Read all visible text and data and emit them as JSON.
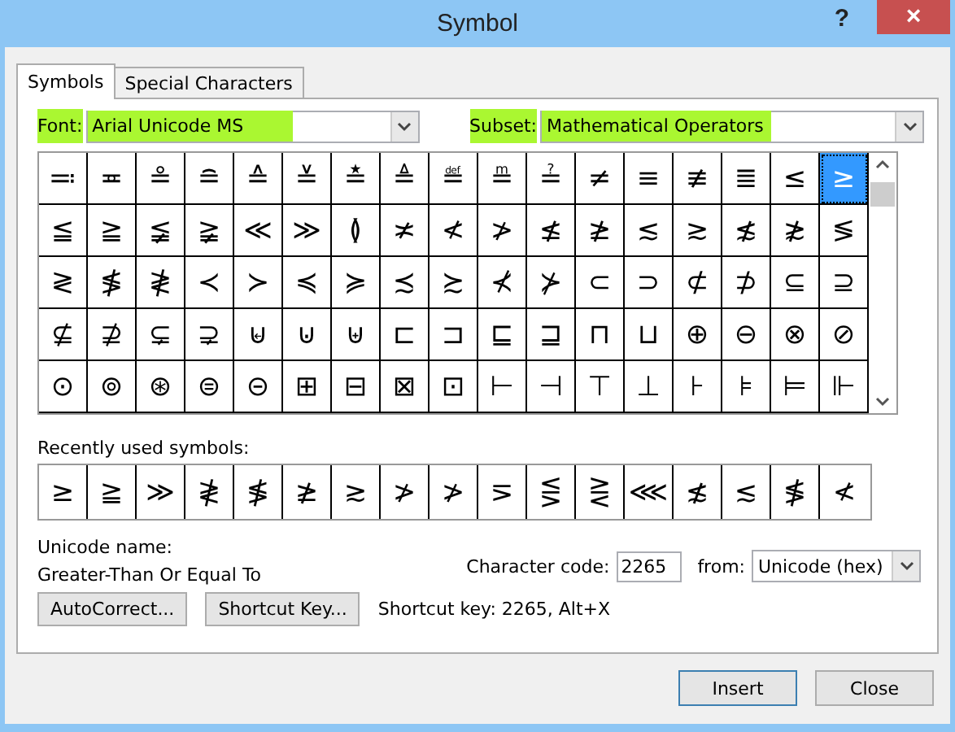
{
  "window": {
    "title": "Symbol",
    "help": "?",
    "close": "×"
  },
  "tabs": [
    {
      "label": "Symbols",
      "selected": true
    },
    {
      "label": "Special Characters",
      "selected": false
    }
  ],
  "font": {
    "label": "Font:",
    "value": "Arial Unicode MS",
    "highlighted": true
  },
  "subset": {
    "label": "Subset:",
    "value": "Mathematical Operators",
    "highlighted": true
  },
  "symbols": [
    {
      "char": "≕",
      "selected": false
    },
    {
      "char": "≖",
      "selected": false
    },
    {
      "char": "≗",
      "selected": false
    },
    {
      "char": "≘",
      "selected": false
    },
    {
      "char": "≙",
      "selected": false
    },
    {
      "char": "≚",
      "selected": false
    },
    {
      "char": "≛",
      "selected": false
    },
    {
      "char": "≜",
      "selected": false
    },
    {
      "char": "≝",
      "selected": false
    },
    {
      "char": "≞",
      "selected": false
    },
    {
      "char": "≟",
      "selected": false
    },
    {
      "char": "≠",
      "selected": false
    },
    {
      "char": "≡",
      "selected": false
    },
    {
      "char": "≢",
      "selected": false
    },
    {
      "char": "≣",
      "selected": false
    },
    {
      "char": "≤",
      "selected": false
    },
    {
      "char": "≥",
      "selected": true
    },
    {
      "char": "≦",
      "selected": false
    },
    {
      "char": "≧",
      "selected": false
    },
    {
      "char": "≨",
      "selected": false
    },
    {
      "char": "≩",
      "selected": false
    },
    {
      "char": "≪",
      "selected": false
    },
    {
      "char": "≫",
      "selected": false
    },
    {
      "char": "≬",
      "selected": false
    },
    {
      "char": "≭",
      "selected": false
    },
    {
      "char": "≮",
      "selected": false
    },
    {
      "char": "≯",
      "selected": false
    },
    {
      "char": "≰",
      "selected": false
    },
    {
      "char": "≱",
      "selected": false
    },
    {
      "char": "≲",
      "selected": false
    },
    {
      "char": "≳",
      "selected": false
    },
    {
      "char": "≴",
      "selected": false
    },
    {
      "char": "≵",
      "selected": false
    },
    {
      "char": "≶",
      "selected": false
    },
    {
      "char": "≷",
      "selected": false
    },
    {
      "char": "≸",
      "selected": false
    },
    {
      "char": "≹",
      "selected": false
    },
    {
      "char": "≺",
      "selected": false
    },
    {
      "char": "≻",
      "selected": false
    },
    {
      "char": "≼",
      "selected": false
    },
    {
      "char": "≽",
      "selected": false
    },
    {
      "char": "≾",
      "selected": false
    },
    {
      "char": "≿",
      "selected": false
    },
    {
      "char": "⊀",
      "selected": false
    },
    {
      "char": "⊁",
      "selected": false
    },
    {
      "char": "⊂",
      "selected": false
    },
    {
      "char": "⊃",
      "selected": false
    },
    {
      "char": "⊄",
      "selected": false
    },
    {
      "char": "⊅",
      "selected": false
    },
    {
      "char": "⊆",
      "selected": false
    },
    {
      "char": "⊇",
      "selected": false
    },
    {
      "char": "⊈",
      "selected": false
    },
    {
      "char": "⊉",
      "selected": false
    },
    {
      "char": "⊊",
      "selected": false
    },
    {
      "char": "⊋",
      "selected": false
    },
    {
      "char": "⊌",
      "selected": false
    },
    {
      "char": "⊍",
      "selected": false
    },
    {
      "char": "⊎",
      "selected": false
    },
    {
      "char": "⊏",
      "selected": false
    },
    {
      "char": "⊐",
      "selected": false
    },
    {
      "char": "⊑",
      "selected": false
    },
    {
      "char": "⊒",
      "selected": false
    },
    {
      "char": "⊓",
      "selected": false
    },
    {
      "char": "⊔",
      "selected": false
    },
    {
      "char": "⊕",
      "selected": false
    },
    {
      "char": "⊖",
      "selected": false
    },
    {
      "char": "⊗",
      "selected": false
    },
    {
      "char": "⊘",
      "selected": false
    },
    {
      "char": "⊙",
      "selected": false
    },
    {
      "char": "⊚",
      "selected": false
    },
    {
      "char": "⊛",
      "selected": false
    },
    {
      "char": "⊜",
      "selected": false
    },
    {
      "char": "⊝",
      "selected": false
    },
    {
      "char": "⊞",
      "selected": false
    },
    {
      "char": "⊟",
      "selected": false
    },
    {
      "char": "⊠",
      "selected": false
    },
    {
      "char": "⊡",
      "selected": false
    },
    {
      "char": "⊢",
      "selected": false
    },
    {
      "char": "⊣",
      "selected": false
    },
    {
      "char": "⊤",
      "selected": false
    },
    {
      "char": "⊥",
      "selected": false
    },
    {
      "char": "⊦",
      "selected": false
    },
    {
      "char": "⊧",
      "selected": false
    },
    {
      "char": "⊨",
      "selected": false
    },
    {
      "char": "⊩",
      "selected": false
    }
  ],
  "recent": {
    "label": "Recently used symbols:",
    "symbols": [
      "≥",
      "≧",
      "≫",
      "≹",
      "≸",
      "≱",
      "≳",
      "≯",
      "≯",
      "⋝",
      "⋚",
      "⋛",
      "⋘",
      "≴",
      "≲",
      "≸",
      "≮"
    ]
  },
  "unicode_name": {
    "label": "Unicode name:",
    "value": "Greater-Than Or Equal To"
  },
  "character_code": {
    "label": "Character code:",
    "value": "2265"
  },
  "from": {
    "label": "from:",
    "value": "Unicode (hex)"
  },
  "autocorrect_button": "AutoCorrect...",
  "shortcut_key_button": "Shortcut Key...",
  "shortcut_text": "Shortcut key: 2265, Alt+X",
  "insert_button": "Insert",
  "close_button": "Close"
}
